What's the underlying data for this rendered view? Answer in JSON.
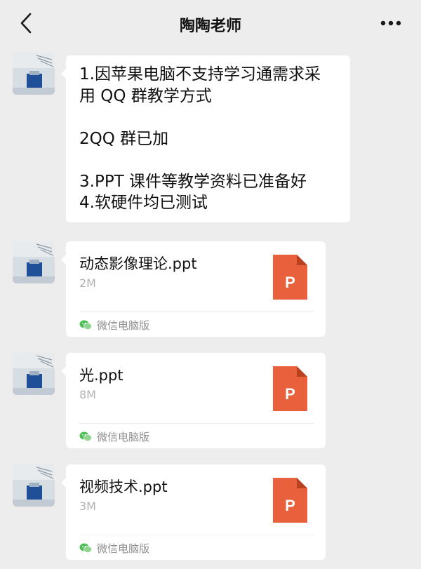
{
  "header": {
    "title": "陶陶老师",
    "back_icon": "chevron-left-icon",
    "more_icon": "more-dots-icon"
  },
  "messages": [
    {
      "type": "text",
      "lines": [
        "1.因苹果电脑不支持学习通需求采",
        "用 QQ 群教学方式",
        "",
        "2QQ 群已加",
        "",
        "3.PPT 课件等教学资料已准备好",
        "4.软硬件均已测试"
      ]
    },
    {
      "type": "file",
      "file_name": "动态影像理论.ppt",
      "file_size": "2M",
      "file_icon_letter": "P",
      "source_label": "微信电脑版"
    },
    {
      "type": "file",
      "file_name": "光.ppt",
      "file_size": "8M",
      "file_icon_letter": "P",
      "source_label": "微信电脑版"
    },
    {
      "type": "file",
      "file_name": "视频技术.ppt",
      "file_size": "3M",
      "file_icon_letter": "P",
      "source_label": "微信电脑版"
    }
  ],
  "colors": {
    "background": "#ededed",
    "bubble": "#ffffff",
    "ppt_icon": "#e8613c",
    "wechat_green": "#4bbf55"
  }
}
